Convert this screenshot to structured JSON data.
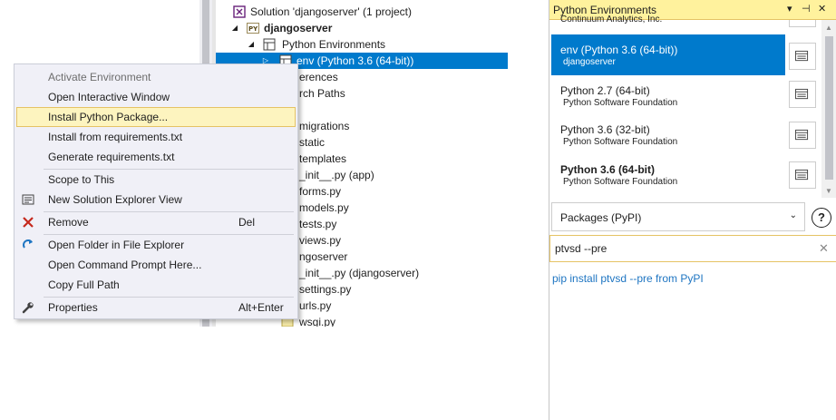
{
  "solution_explorer": {
    "rows": [
      {
        "label": "Solution 'djangoserver' (1 project)",
        "icon": "vs-solution-icon"
      },
      {
        "label": "djangoserver",
        "icon": "python-project-icon"
      },
      {
        "label": "Python Environments",
        "icon": "python-environments-icon"
      },
      {
        "label": "env (Python 3.6 (64-bit))",
        "icon": "python-env-icon"
      },
      {
        "label": "erences"
      },
      {
        "label": "rch Paths"
      },
      {
        "label": "migrations"
      },
      {
        "label": "static"
      },
      {
        "label": "templates"
      },
      {
        "label": "_init__.py (app)"
      },
      {
        "label": "forms.py"
      },
      {
        "label": "models.py"
      },
      {
        "label": "tests.py"
      },
      {
        "label": "views.py"
      },
      {
        "label": "ngoserver"
      },
      {
        "label": "_init__.py (djangoserver)"
      },
      {
        "label": "settings.py"
      },
      {
        "label": "urls.py"
      },
      {
        "label": "wsgi.py"
      }
    ]
  },
  "context_menu": {
    "items": [
      {
        "label": "Activate Environment"
      },
      {
        "label": "Open Interactive Window"
      },
      {
        "label": "Install Python Package..."
      },
      {
        "label": "Install from requirements.txt"
      },
      {
        "label": "Generate requirements.txt"
      },
      {
        "label": "Scope to This"
      },
      {
        "label": "New Solution Explorer View",
        "icon": "new-view-icon"
      },
      {
        "label": "Remove",
        "shortcut": "Del",
        "icon": "remove-x-icon"
      },
      {
        "label": "Open Folder in File Explorer",
        "icon": "refresh-arrow-icon"
      },
      {
        "label": "Open Command Prompt Here..."
      },
      {
        "label": "Copy Full Path"
      },
      {
        "label": "Properties",
        "shortcut": "Alt+Enter",
        "icon": "wrench-icon"
      }
    ]
  },
  "python_environments": {
    "title": "Python Environments",
    "partial_top": "Continuum Analytics, Inc.",
    "envs": [
      {
        "name": "env (Python 3.6 (64-bit))",
        "sub": "djangoserver"
      },
      {
        "name": "Python 2.7 (64-bit)",
        "sub": "Python Software Foundation"
      },
      {
        "name": "Python 3.6 (32-bit)",
        "sub": "Python Software Foundation"
      },
      {
        "name": "Python 3.6 (64-bit)",
        "sub": "Python Software Foundation"
      }
    ],
    "packages_select": "Packages (PyPI)",
    "help": "?",
    "search_value": "ptvsd --pre",
    "pip_link": "pip install ptvsd --pre from PyPI"
  },
  "colors": {
    "selection": "#007acc",
    "highlight": "#fdf4bf",
    "title_bar": "#fff29d",
    "link": "#1e75c2"
  }
}
